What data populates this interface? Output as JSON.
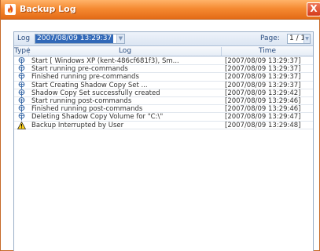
{
  "window": {
    "title": "Backup Log",
    "close_label": "X",
    "accent_color": "#f58a32"
  },
  "toolbar": {
    "log_label": "Log",
    "log_selected": "2007/08/09 13:29:37",
    "page_label": "Page:",
    "page_value": "1 / 1"
  },
  "columns": {
    "type": "Type",
    "log": "Log",
    "time": "Time"
  },
  "rows": [
    {
      "icon": "info-icon",
      "log": "Start [ Windows XP (kent-486cf681f3), Sm...",
      "time": "[2007/08/09 13:29:37]"
    },
    {
      "icon": "info-icon",
      "log": "Start running pre-commands",
      "time": "[2007/08/09 13:29:37]"
    },
    {
      "icon": "info-icon",
      "log": "Finished running pre-commands",
      "time": "[2007/08/09 13:29:37]"
    },
    {
      "icon": "info-icon",
      "log": "Start Creating Shadow Copy Set ...",
      "time": "[2007/08/09 13:29:37]"
    },
    {
      "icon": "info-icon",
      "log": "Shadow Copy Set successfully created",
      "time": "[2007/08/09 13:29:42]"
    },
    {
      "icon": "info-icon",
      "log": "Start running post-commands",
      "time": "[2007/08/09 13:29:46]"
    },
    {
      "icon": "info-icon",
      "log": "Finished running post-commands",
      "time": "[2007/08/09 13:29:46]"
    },
    {
      "icon": "info-icon",
      "log": "Deleting Shadow Copy Volume for \"C:\\\"",
      "time": "[2007/08/09 13:29:47]"
    },
    {
      "icon": "warning-icon",
      "log": "Backup Interrupted by User",
      "time": "[2007/08/09 13:29:48]"
    }
  ]
}
